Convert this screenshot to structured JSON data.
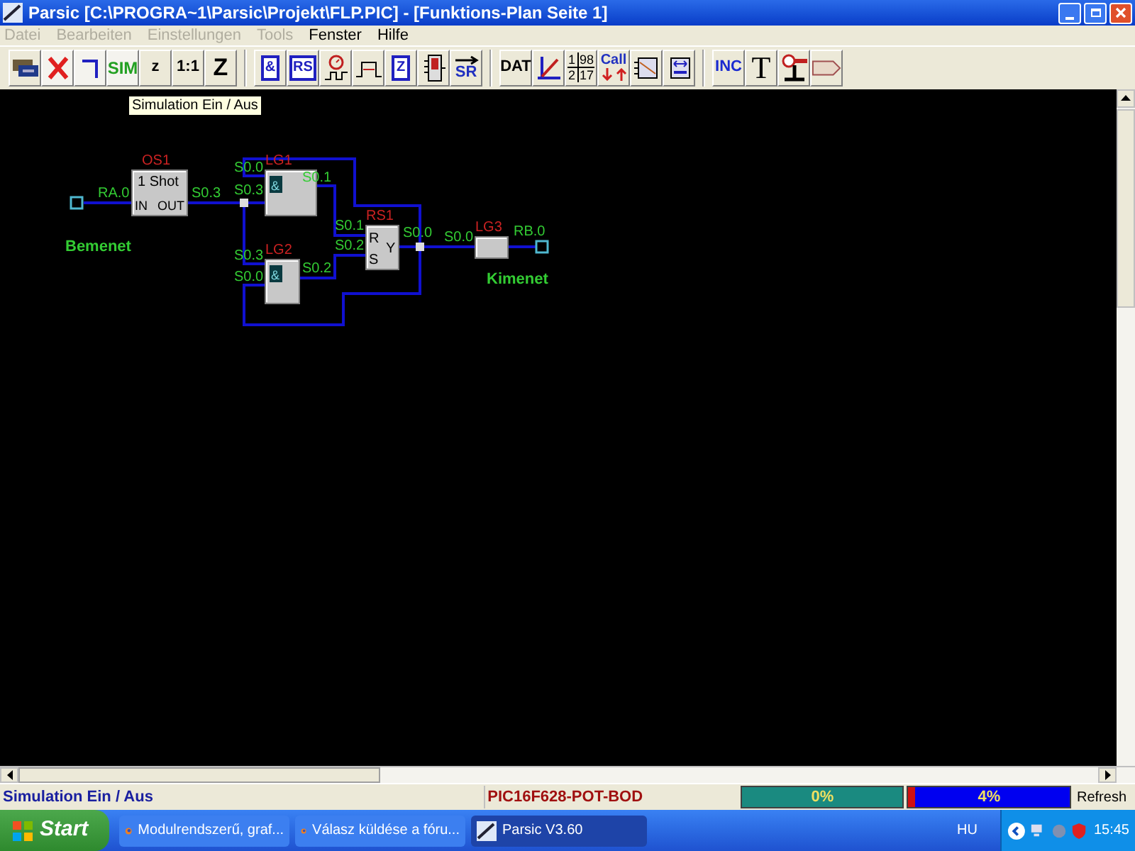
{
  "window": {
    "title": "Parsic [C:\\PROGRA~1\\Parsic\\Projekt\\FLP.PIC] - [Funktions-Plan Seite 1]"
  },
  "menu": [
    {
      "label": "Datei",
      "disabled": true
    },
    {
      "label": "Bearbeiten",
      "disabled": true
    },
    {
      "label": "Einstellungen",
      "disabled": true
    },
    {
      "label": "Tools",
      "disabled": true
    },
    {
      "label": "Fenster",
      "disabled": false
    },
    {
      "label": "Hilfe",
      "disabled": false
    }
  ],
  "toolbar": [
    {
      "buttons": [
        {
          "kind": "icon",
          "pressed": false
        },
        {
          "kind": "icon",
          "pressed": true
        },
        {
          "kind": "icon",
          "pressed": true
        },
        {
          "kind": "text",
          "label": "SIM",
          "pressed": true
        },
        {
          "kind": "text",
          "label": "z",
          "pressed": false
        },
        {
          "kind": "text",
          "label": "1:1",
          "pressed": false
        },
        {
          "kind": "text",
          "label": "Z",
          "pressed": false
        }
      ]
    },
    {
      "buttons": [
        {
          "kind": "gate",
          "label": "&",
          "pressed": false
        },
        {
          "kind": "gate",
          "label": "RS",
          "pressed": false
        },
        {
          "kind": "icon",
          "pressed": false
        },
        {
          "kind": "icon",
          "pressed": false
        },
        {
          "kind": "gate",
          "label": "Z",
          "pressed": false
        },
        {
          "kind": "icon",
          "pressed": false
        },
        {
          "kind": "arrow",
          "label": "SR",
          "pressed": false
        }
      ]
    },
    {
      "buttons": [
        {
          "kind": "text",
          "label": "DAT",
          "pressed": false
        },
        {
          "kind": "icon",
          "pressed": false
        },
        {
          "kind": "fraction",
          "numbers": [
            "1",
            "98",
            "2",
            "17"
          ],
          "pressed": false
        },
        {
          "kind": "call",
          "label": "Call",
          "pressed": false
        },
        {
          "kind": "icon",
          "pressed": false
        },
        {
          "kind": "icon",
          "pressed": false
        }
      ]
    },
    {
      "buttons": [
        {
          "kind": "text",
          "label": "INC",
          "pressed": false
        },
        {
          "kind": "text",
          "label": "T",
          "pressed": false
        },
        {
          "kind": "icon",
          "pressed": false
        },
        {
          "kind": "icon",
          "pressed": false
        }
      ]
    }
  ],
  "tooltip": "Simulation Ein / Aus",
  "diagram": {
    "blocks": [
      {
        "name": "OS1",
        "texts": [
          "1 Shot",
          "IN",
          "OUT"
        ]
      },
      {
        "name": "LG1",
        "texts": [
          "&"
        ]
      },
      {
        "name": "LG2",
        "texts": [
          "&"
        ]
      },
      {
        "name": "RS1",
        "texts": [
          "R",
          "S",
          "Y"
        ]
      },
      {
        "name": "LG3"
      }
    ],
    "signals": [
      "RA.0",
      "S0.3",
      "S0.0",
      "S0.3",
      "S0.1",
      "S0.3",
      "S0.0",
      "S0.2",
      "S0.1",
      "S0.2",
      "S0.0",
      "S0.0",
      "RB.0"
    ],
    "captions": [
      "Bemenet",
      "Kimenet"
    ]
  },
  "status_bar": {
    "message": "Simulation Ein / Aus",
    "device": "PIC16F628-POT-BOD",
    "meters": [
      {
        "reading": "0%"
      },
      {
        "reading": "4%",
        "level": 0.04
      }
    ],
    "button": "Refresh"
  },
  "taskbar": {
    "start": "Start",
    "tasks": [
      {
        "label": "Modulrendszerű, graf...",
        "selected": false
      },
      {
        "label": "Válasz küldése a fóru...",
        "selected": false
      },
      {
        "label": "Parsic V3.60",
        "selected": true
      }
    ],
    "language": "HU",
    "clock": "15:45"
  }
}
